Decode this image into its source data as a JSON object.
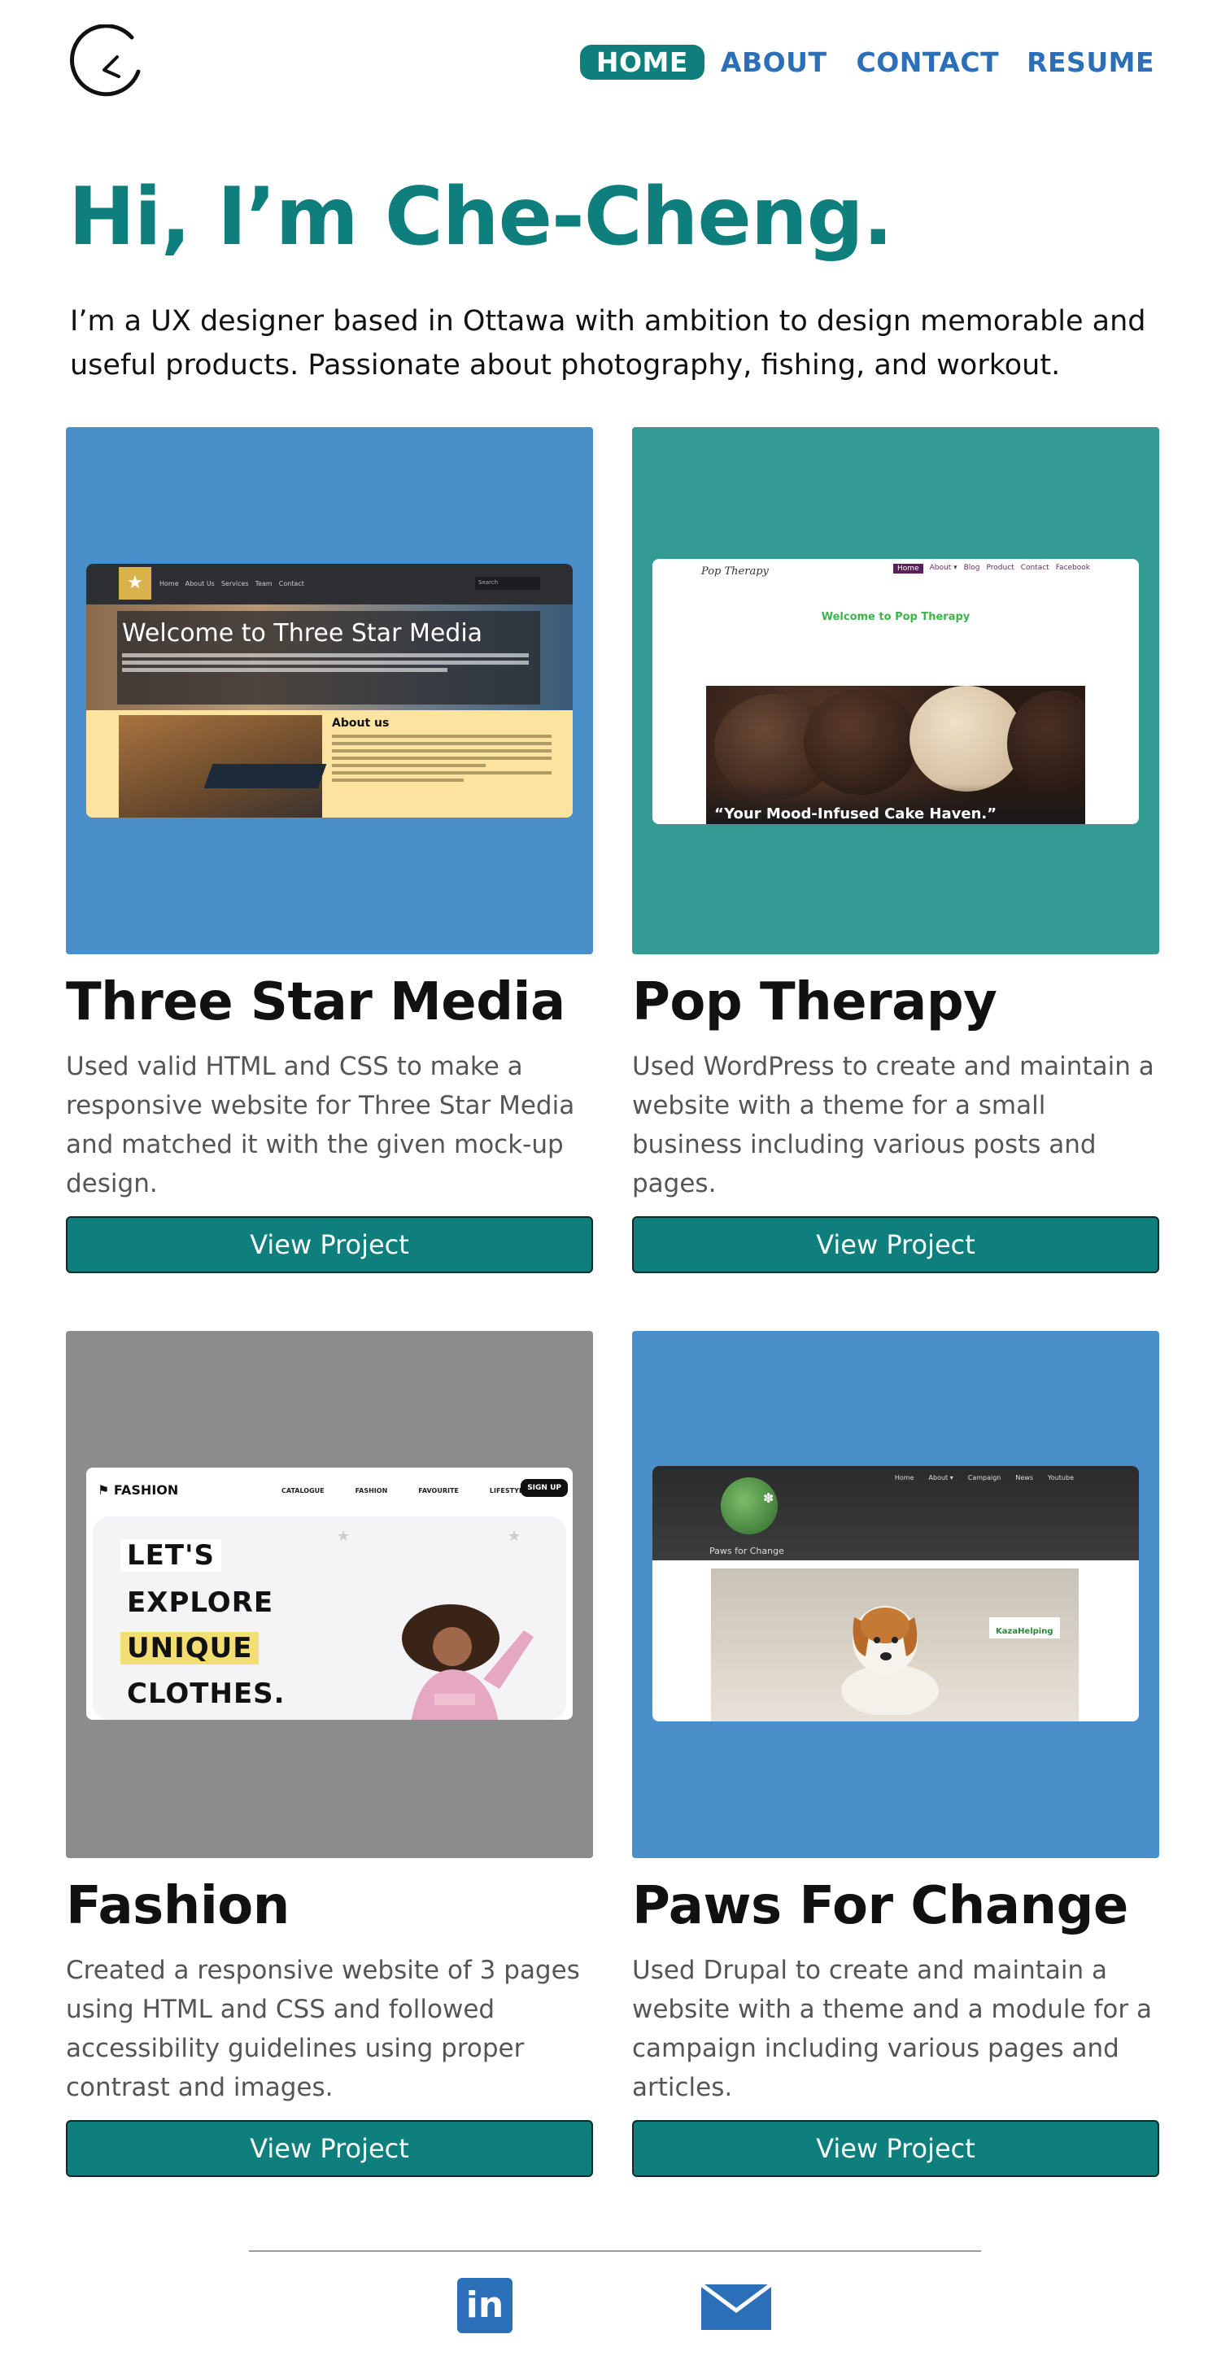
{
  "header": {
    "logo_icon": "clock-icon",
    "nav": {
      "home": "HOME",
      "about": "ABOUT",
      "contact": "CONTACT",
      "resume": "RESUME"
    }
  },
  "hero": {
    "title": "Hi, I’m Che-Cheng.",
    "subtitle": "I’m a UX designer based in Ottawa with ambition to design memorable and useful products. Passionate about photography, fishing, and workout."
  },
  "projects": [
    {
      "title": "Three Star Media",
      "description": "Used valid HTML and CSS to make a responsive website for Three Star Media and matched it with the given mock-up design.",
      "button": "View Project",
      "thumb_color": "#4a8fc9",
      "preview": {
        "nav_items": [
          "Home",
          "About Us",
          "Services",
          "Team",
          "Contact"
        ],
        "search": "Search",
        "headline": "Welcome to Three Star Media",
        "section": "About us"
      }
    },
    {
      "title": "Pop Therapy",
      "description": "Used WordPress to create and maintain a website with a theme for a small business including various posts and pages.",
      "button": "View Project",
      "thumb_color": "#339a94",
      "preview": {
        "logo": "Pop Therapy",
        "nav_items": [
          "Home",
          "About ▾",
          "Blog",
          "Product",
          "Contact",
          "Facebook"
        ],
        "welcome": "Welcome to Pop Therapy",
        "caption": "“Your Mood-Infused Cake Haven.”"
      }
    },
    {
      "title": "Fashion",
      "description": "Created a responsive website of 3 pages using HTML and CSS and followed accessibility guidelines using proper contrast and images.",
      "button": "View Project",
      "thumb_color": "#8c8c8c",
      "preview": {
        "logo": "FASHION",
        "nav_items": [
          "CATALOGUE",
          "FASHION",
          "FAVOURITE",
          "LIFESTYLE"
        ],
        "signup": "SIGN UP",
        "headline": [
          "LET'S",
          "EXPLORE",
          "UNIQUE",
          "CLOTHES."
        ]
      }
    },
    {
      "title": "Paws For Change",
      "description": "Used Drupal to create and maintain a website with a theme and a module for a campaign including various pages and articles.",
      "button": "View Project",
      "thumb_color": "#4a8fc9",
      "preview": {
        "tagline": "Paws for Change",
        "nav_items": [
          "Home",
          "About ▾",
          "Campaign",
          "News",
          "Youtube"
        ],
        "badge": "KazaHelping"
      }
    }
  ],
  "footer": {
    "linkedin_icon": "linkedin-icon",
    "linkedin_label": "in",
    "mail_icon": "mail-icon"
  },
  "colors": {
    "teal": "#0e7f7c",
    "nav_blue": "#2a6fb8"
  }
}
